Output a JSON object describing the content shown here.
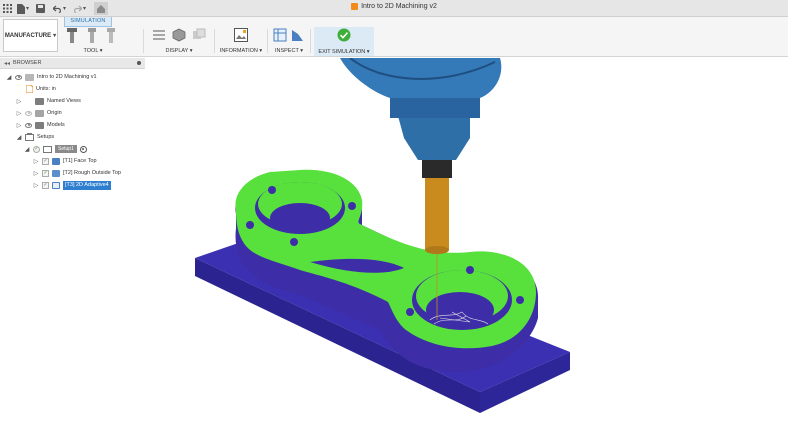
{
  "app": {
    "document_title": "Intro to 2D Machining v2"
  },
  "colors": {
    "part_top": "#58e03c",
    "part_side": "#3d2ea8",
    "stock": "#3a2fb0",
    "spindle": "#2f6fa8",
    "tool_shank": "#c98a1e",
    "accent": "#2f7fd1",
    "finish_green": "#3fae3a"
  },
  "titlebar": {
    "icons": [
      "grid-icon",
      "file-icon",
      "save-icon",
      "undo-icon",
      "redo-icon",
      "home-icon"
    ]
  },
  "ribbon": {
    "context_tab": "SIMULATION",
    "workspace": "MANUFACTURE",
    "groups": {
      "tool": "TOOL",
      "display": "DISPLAY",
      "information": "INFORMATION",
      "inspect": "INSPECT",
      "exit": "EXIT SIMULATION"
    }
  },
  "browser": {
    "header": "BROWSER",
    "items": {
      "root": "Intro to 2D Machining v1",
      "units": "Units: in",
      "named_views": "Named Views",
      "origin": "Origin",
      "models": "Models",
      "setups": "Setups",
      "setup1": "Setup1",
      "op1": "[T1] Face Top",
      "op2": "[T2] Rough Outside Top",
      "op3": "[T3] 2D Adaptive4"
    }
  }
}
